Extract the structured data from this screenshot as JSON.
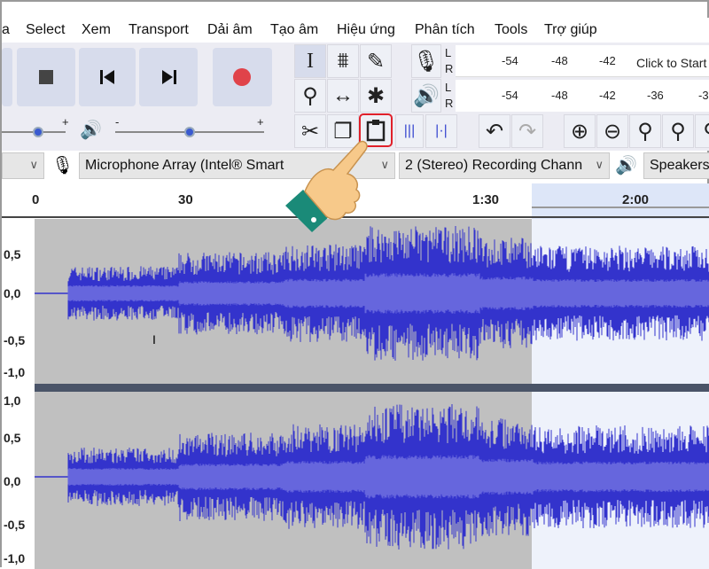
{
  "menu": [
    "a",
    "Select",
    "Xem",
    "Transport",
    "Dải âm",
    "Tạo âm",
    "Hiệu ứng",
    "Phân tích",
    "Tools",
    "Trợ giúp"
  ],
  "meters": {
    "record_ticks": [
      "-54",
      "-48",
      "-42"
    ],
    "record_prompt": "Click to Start",
    "play_ticks": [
      "-54",
      "-48",
      "-42",
      "-36",
      "-3"
    ],
    "l": "L",
    "r": "R"
  },
  "sliders": {
    "minus": "-",
    "plus": "+",
    "recording_volume": 0.78,
    "playback_volume": 0.55
  },
  "devices": {
    "host": "",
    "input": "Microphone Array (Intel® Smart",
    "channels": "2 (Stereo) Recording Chann",
    "output": "Speakers"
  },
  "timeline": {
    "labels": [
      "0",
      "30",
      "1:30",
      "2:00"
    ]
  },
  "tracks": [
    {
      "scale": [
        "0,5",
        "0,0",
        "-0,5",
        "-1,0"
      ]
    },
    {
      "scale": [
        "1,0",
        "0,5",
        "0,0",
        "-0,5",
        "-1,0"
      ]
    }
  ],
  "highlight": {
    "button": "paste",
    "color": "#e0202a"
  },
  "colors": {
    "waveform": "#3333cc",
    "rms": "#6666dd",
    "selected_bg": "#c0c0c0",
    "unselected_bg": "#eef2fb",
    "record": "#e0434a"
  }
}
